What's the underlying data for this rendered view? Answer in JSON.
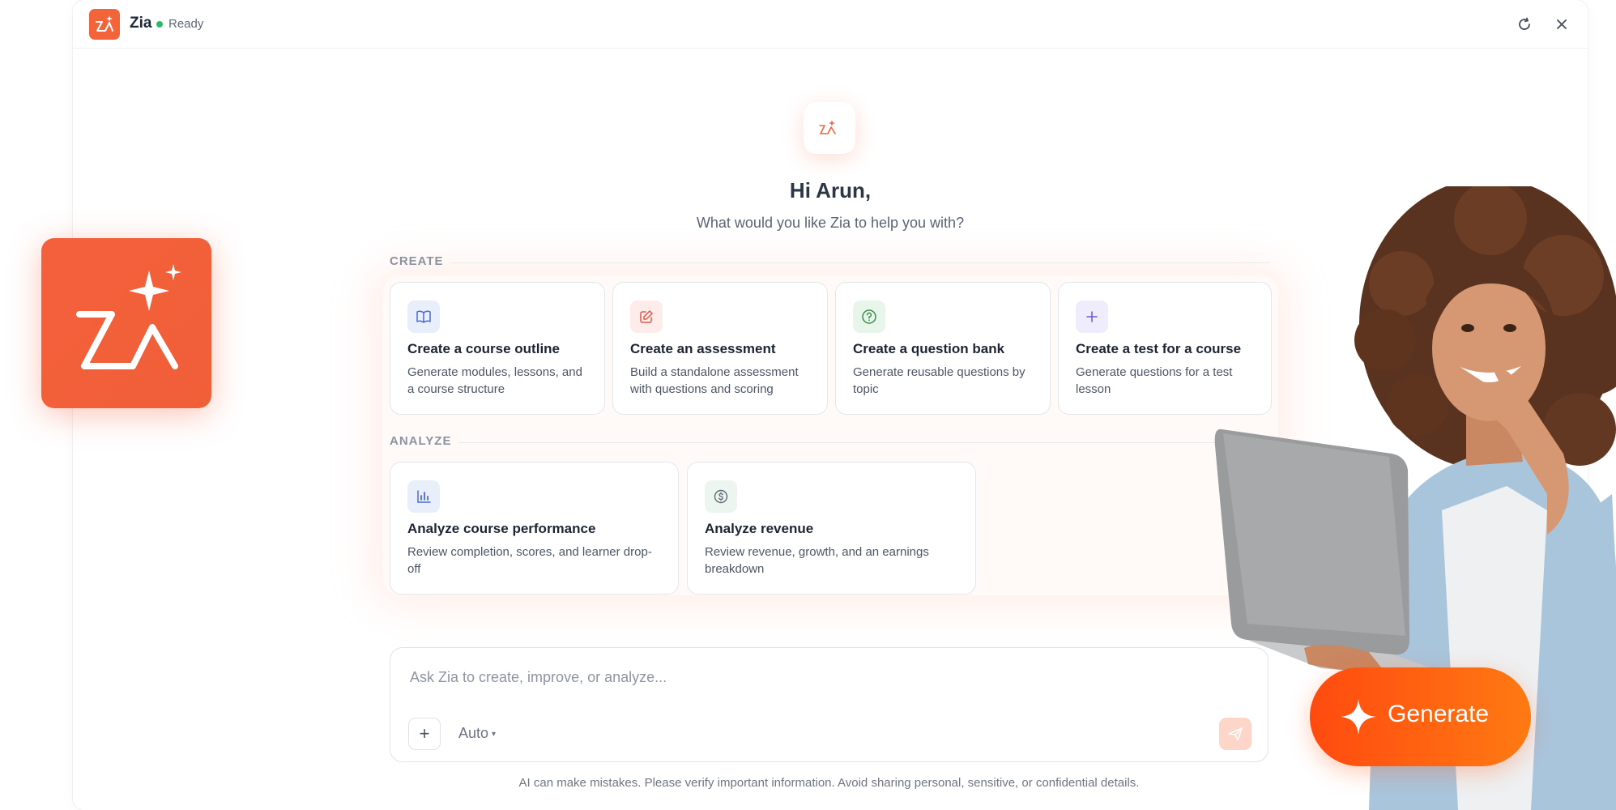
{
  "app": {
    "name": "Zia",
    "status": "Ready"
  },
  "hero": {
    "greeting": "Hi Arun,",
    "subtitle": "What would you like Zia to help you with?"
  },
  "sections": {
    "create": {
      "label": "CREATE",
      "cards": [
        {
          "title": "Create a course outline",
          "desc": "Generate modules, lessons, and a course structure",
          "icon": "book-icon"
        },
        {
          "title": "Create an assessment",
          "desc": "Build a standalone assessment with questions and scoring",
          "icon": "edit-icon"
        },
        {
          "title": "Create a question bank",
          "desc": "Generate reusable questions by topic",
          "icon": "question-icon"
        },
        {
          "title": "Create a test for a course",
          "desc": "Generate questions for a test lesson",
          "icon": "plus-icon"
        }
      ]
    },
    "analyze": {
      "label": "ANALYZE",
      "cards": [
        {
          "title": "Analyze course performance",
          "desc": "Review completion, scores, and learner drop-off",
          "icon": "bar-chart-icon"
        },
        {
          "title": "Analyze revenue",
          "desc": "Review revenue, growth, and an earnings breakdown",
          "icon": "dollar-icon"
        }
      ]
    }
  },
  "composer": {
    "placeholder": "Ask Zia to create, improve, or analyze...",
    "mode": "Auto",
    "add_label": "+"
  },
  "disclaimer": "AI can make mistakes. Please verify important information. Avoid sharing personal, sensitive, or confidential details.",
  "generate_button": {
    "label": "Generate"
  },
  "colors": {
    "accent": "#f4643a",
    "status_green": "#2fb86b",
    "generate_start": "#ff4a10",
    "generate_end": "#ff7a12"
  }
}
